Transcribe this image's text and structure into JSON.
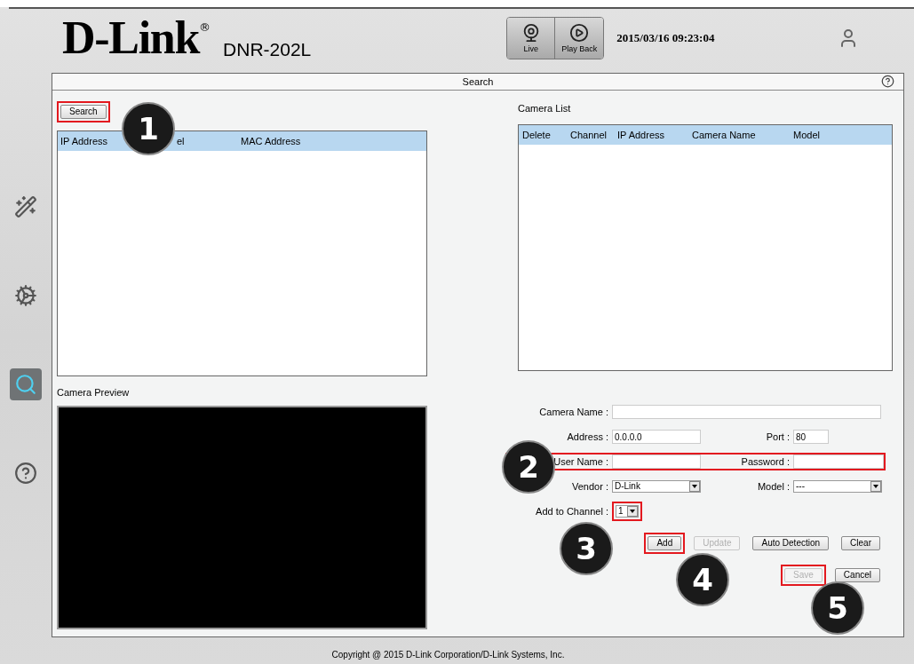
{
  "header": {
    "logo": "D-Link",
    "logo_mark": "®",
    "model": "DNR-202L",
    "nav": [
      {
        "label": "Live",
        "kind": "live"
      },
      {
        "label": "Play Back",
        "kind": "playback"
      }
    ],
    "datetime": "2015/03/16 09:23:04"
  },
  "sidebar": {
    "items": [
      {
        "kind": "wizard",
        "selected": false
      },
      {
        "kind": "settings",
        "selected": false
      },
      {
        "kind": "search",
        "selected": true
      },
      {
        "kind": "help",
        "selected": false
      }
    ]
  },
  "panel": {
    "title": "Search",
    "search_button": {
      "label": "Search",
      "highlighted": true
    },
    "search_table": {
      "columns": [
        "IP Address",
        "el",
        "MAC Address"
      ]
    },
    "camera_list": {
      "title": "Camera List",
      "columns": [
        "Delete",
        "Channel",
        "IP Address",
        "Camera Name",
        "Model"
      ]
    },
    "preview": {
      "title": "Camera Preview"
    },
    "form": {
      "rows": [
        {
          "highlighted": false,
          "fields": [
            {
              "label": "Camera Name :",
              "kind": "wide"
            }
          ]
        },
        {
          "highlighted": false,
          "fields": [
            {
              "label": "Address :",
              "kind": "text",
              "value": "0.0.0.0"
            },
            {
              "label": "Port :",
              "kind": "text",
              "value": "80"
            }
          ]
        },
        {
          "highlighted": true,
          "fields": [
            {
              "label": "User Name :",
              "kind": "text"
            },
            {
              "label": "Password :",
              "kind": "text"
            }
          ]
        },
        {
          "highlighted": false,
          "fields": [
            {
              "label": "Vendor :",
              "kind": "select",
              "value": "D-Link"
            },
            {
              "label": "Model :",
              "kind": "select",
              "value": "---"
            }
          ]
        },
        {
          "highlighted": false,
          "fields": [
            {
              "label": "Add to Channel :",
              "kind": "small-select",
              "value": "1",
              "highlighted": true
            }
          ]
        }
      ],
      "buttons": [
        [
          {
            "label": "Add",
            "disabled": false,
            "highlighted": true
          },
          {
            "label": "Update",
            "disabled": true,
            "highlighted": false
          },
          {
            "label": "Auto Detection",
            "disabled": false,
            "highlighted": false
          },
          {
            "label": "Clear",
            "disabled": false,
            "highlighted": false
          }
        ],
        [
          {
            "label": "Save",
            "disabled": true,
            "highlighted": true
          },
          {
            "label": "Cancel",
            "disabled": false,
            "highlighted": false
          }
        ]
      ]
    }
  },
  "callouts": [
    "1",
    "2",
    "3",
    "4",
    "5"
  ],
  "footer": "Copyright @ 2015 D-Link Corporation/D-Link Systems, Inc."
}
